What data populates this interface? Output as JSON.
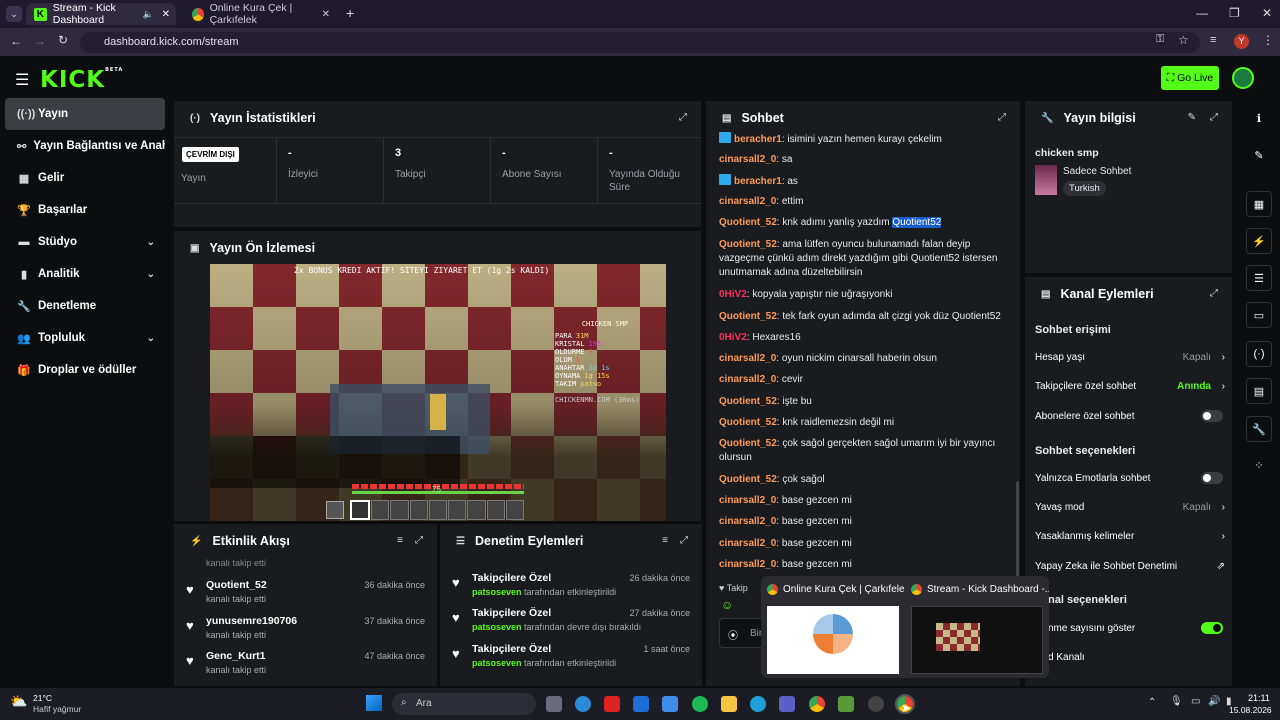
{
  "browser": {
    "tabs": [
      {
        "title": "Stream - Kick Dashboard",
        "active": true
      },
      {
        "title": "Online Kura Çek | Çarkıfelek",
        "active": false
      }
    ],
    "new_tab": "+",
    "url": "dashboard.kick.com/stream",
    "profile_initial": "Y"
  },
  "header": {
    "logo": "KICK",
    "logo_sup": "BETA",
    "go_live": "Go Live"
  },
  "sidebar": {
    "items": [
      {
        "label": "Yayın",
        "icon": "broadcast-icon"
      },
      {
        "label": "Yayın Bağlantısı ve Anahtar",
        "icon": "link-icon"
      },
      {
        "label": "Gelir",
        "icon": "chart-icon"
      },
      {
        "label": "Başarılar",
        "icon": "trophy-icon"
      },
      {
        "label": "Stüdyo",
        "icon": "studio-icon"
      },
      {
        "label": "Analitik",
        "icon": "analytics-icon"
      },
      {
        "label": "Denetleme",
        "icon": "wrench-icon"
      },
      {
        "label": "Topluluk",
        "icon": "community-icon"
      },
      {
        "label": "Droplar ve ödüller",
        "icon": "gift-icon"
      }
    ]
  },
  "stats": {
    "title": "Yayın İstatistikleri",
    "offline_badge": "ÇEVRİM DIŞI",
    "items": [
      {
        "label": "Yayın",
        "value": ""
      },
      {
        "label": "İzleyici",
        "value": "-"
      },
      {
        "label": "Takipçi",
        "value": "3"
      },
      {
        "label": "Abone Sayısı",
        "value": "-"
      },
      {
        "label": "Yayında Olduğu Süre",
        "value": "-"
      }
    ]
  },
  "preview": {
    "title": "Yayın Ön İzlemesi",
    "game_banner": "2x BONUS KREDI AKTIF! SITEYI ZIYARET ET (1g 2s KALDI)",
    "scoreboard_title": "CHICKEN SMP",
    "scoreboard": [
      {
        "label": "PARA",
        "value": "31M"
      },
      {
        "label": "KRISTAL",
        "value": "195"
      },
      {
        "label": "OLDURME",
        "value": "0"
      },
      {
        "label": "OLUM",
        "value": "3"
      },
      {
        "label": "ANAHTAR",
        "value": "5d 1s"
      },
      {
        "label": "OYNAMA",
        "value": "1g 15s"
      },
      {
        "label": "TAKIM",
        "value": "patso"
      }
    ],
    "server": "CHICKENMN.COM (30ms)",
    "xp_level": "75"
  },
  "activity": {
    "title": "Etkinlik Akışı",
    "cut_top": "kanalı takip etti",
    "rows": [
      {
        "name": "Quotient_52",
        "sub": "kanalı takip etti",
        "time": "36 dakika önce"
      },
      {
        "name": "yunusemre190706",
        "sub": "kanalı takip etti",
        "time": "37 dakika önce"
      },
      {
        "name": "Genc_Kurt1",
        "sub": "kanalı takip etti",
        "time": "47 dakika önce"
      }
    ]
  },
  "moderation": {
    "title": "Denetim Eylemleri",
    "rows": [
      {
        "name": "Takipçilere Özel",
        "user": "patsoseven",
        "sub": "tarafından etkinleştirildi",
        "time": "26 dakika önce"
      },
      {
        "name": "Takipçilere Özel",
        "user": "patsoseven",
        "sub": "tarafından devre dışı bırakıldı",
        "time": "27 dakika önce"
      },
      {
        "name": "Takipçilere Özel",
        "user": "patsoseven",
        "sub": "tarafından etkinleştirildi",
        "time": "1 saat önce"
      }
    ]
  },
  "chat": {
    "title": "Sohbet",
    "messages": [
      {
        "user": "beracher1",
        "text": "isimini yazın hemen kurayı çekelim",
        "badge": true,
        "cls": "u-b"
      },
      {
        "user": "cinarsall2_0",
        "text": "sa",
        "cls": "u-o"
      },
      {
        "user": "beracher1",
        "text": "as",
        "badge": true,
        "cls": "u-b"
      },
      {
        "user": "cinarsall2_0",
        "text": "ettim",
        "cls": "u-o"
      },
      {
        "user": "Quotient_52",
        "text": "knk adımı yanlış yazdım",
        "highlight": "Quotient52",
        "cls": "u-p"
      },
      {
        "user": "Quotient_52",
        "text": "ama lütfen oyuncu bulunamadı falan deyip vazgeçme çünkü adım direkt yazdığım gibi Quotient52 istersen unutmamak adına düzeltebilirsin",
        "cls": "u-p"
      },
      {
        "user": "0HiV2",
        "text": "kopyala yapıştır nie uğraşıyonki",
        "cls": "u-r"
      },
      {
        "user": "Quotient_52",
        "text": "tek fark oyun adımda alt çizgi yok düz Quotient52",
        "cls": "u-p"
      },
      {
        "user": "0HiV2",
        "text": "Hexares16",
        "cls": "u-r"
      },
      {
        "user": "cinarsall2_0",
        "text": "oyun nickim cinarsall haberin olsun",
        "cls": "u-o"
      },
      {
        "user": "cinarsall2_0",
        "text": "cevir",
        "cls": "u-o"
      },
      {
        "user": "Quotient_52",
        "text": "işte bu",
        "cls": "u-p"
      },
      {
        "user": "Quotient_52",
        "text": "knk raidlemezsin değil mi",
        "cls": "u-p"
      },
      {
        "user": "Quotient_52",
        "text": "çok sağol gerçekten sağol umarım iyi bir yayıncı olursun",
        "cls": "u-p"
      },
      {
        "user": "Quotient_52",
        "text": "çok sağol",
        "cls": "u-p"
      },
      {
        "user": "cinarsall2_0",
        "text": "base gezcen mi",
        "cls": "u-o"
      },
      {
        "user": "cinarsall2_0",
        "text": "base gezcen mi",
        "cls": "u-o"
      },
      {
        "user": "cinarsall2_0",
        "text": "base gezcen mi",
        "cls": "u-o"
      },
      {
        "user": "cinarsall2_0",
        "text": "base gezcen mi",
        "cls": "u-o"
      }
    ],
    "followers_label": "Takip",
    "input_placeholder": "Bir"
  },
  "stream_info": {
    "title": "Yayın bilgisi",
    "stream_title": "chicken smp",
    "category": "Sadece Sohbet",
    "tag": "Turkish"
  },
  "channel_actions": {
    "title": "Kanal Eylemleri",
    "section1": "Sohbet erişimi",
    "rows1": [
      {
        "label": "Hesap yaşı",
        "value": "Kapalı",
        "kind": "value"
      },
      {
        "label": "Takipçilere özel sohbet",
        "value": "Anında",
        "kind": "value-green"
      },
      {
        "label": "Abonelere özel sohbet",
        "kind": "toggle",
        "on": false
      }
    ],
    "section2": "Sohbet seçenekleri",
    "rows2": [
      {
        "label": "Yalnızca Emotlarla sohbet",
        "kind": "toggle",
        "on": false
      },
      {
        "label": "Yavaş mod",
        "value": "Kapalı",
        "kind": "value"
      },
      {
        "label": "Yasaklanmış kelimeler",
        "kind": "arrow"
      },
      {
        "label": "Yapay Zeka ile Sohbet Denetimi",
        "kind": "external"
      }
    ],
    "section3": "nal seçenekleri",
    "rows3": [
      {
        "label": "nme sayısını göster",
        "kind": "toggle",
        "on": true
      },
      {
        "label": "d Kanalı",
        "kind": "none"
      }
    ]
  },
  "thumbnails": [
    {
      "title": "Online Kura Çek | Çarkıfele..."
    },
    {
      "title": "Stream - Kick Dashboard -..."
    }
  ],
  "taskbar": {
    "weather_temp": "21°C",
    "weather_desc": "Hafif yağmur",
    "search_placeholder": "Ara",
    "time": "21:11",
    "date": "15.08.2026"
  },
  "colors": {
    "brand": "#53fc18",
    "panel": "#191b1f",
    "bg": "#0b0d0f"
  }
}
